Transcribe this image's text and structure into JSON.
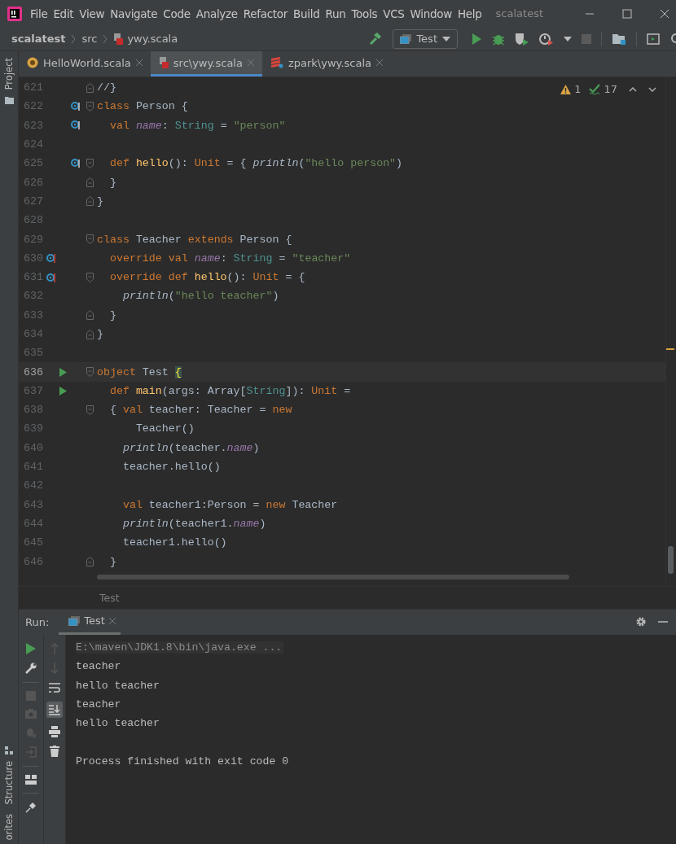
{
  "window": {
    "title": "scalatest",
    "menu": [
      "File",
      "Edit",
      "View",
      "Navigate",
      "Code",
      "Analyze",
      "Refactor",
      "Build",
      "Run",
      "Tools",
      "VCS",
      "Window",
      "Help"
    ]
  },
  "navbar": {
    "breadcrumbs": [
      "scalatest",
      "src",
      "ywy.scala"
    ],
    "run_config": "Test"
  },
  "tabs": [
    {
      "label": "HelloWorld.scala",
      "selected": false,
      "kind": "object"
    },
    {
      "label": "src\\ywy.scala",
      "selected": true,
      "kind": "file"
    },
    {
      "label": "zpark\\ywy.scala",
      "selected": false,
      "kind": "module"
    }
  ],
  "side_tools": {
    "top": "Project",
    "bottom": [
      "Structure",
      "orites"
    ]
  },
  "inspections": {
    "warnings": "1",
    "weak_warnings": "17"
  },
  "editor": {
    "lines": [
      {
        "number": "621",
        "current": false,
        "fold": {
          "kind": "end"
        },
        "tokens": [
          {
            "text": "//}",
            "kind": "plain"
          }
        ]
      },
      {
        "number": "622",
        "current": false,
        "fold": {
          "kind": "start"
        },
        "marker": {
          "kind": "implemented"
        },
        "tokens": [
          {
            "text": "class ",
            "kind": "kw"
          },
          {
            "text": "Person {",
            "kind": "plain"
          }
        ]
      },
      {
        "number": "623",
        "current": false,
        "marker": {
          "kind": "implemented"
        },
        "tokens": [
          {
            "text": "  val ",
            "kind": "kw"
          },
          {
            "text": "name",
            "kind": "field"
          },
          {
            "text": ": ",
            "kind": "plain"
          },
          {
            "text": "String",
            "kind": "type"
          },
          {
            "text": " = ",
            "kind": "plain"
          },
          {
            "text": "\"person\"",
            "kind": "str"
          }
        ]
      },
      {
        "number": "624",
        "current": false
      },
      {
        "number": "625",
        "current": false,
        "fold": {
          "kind": "start"
        },
        "marker": {
          "kind": "implemented"
        },
        "tokens": [
          {
            "text": "  def ",
            "kind": "kw"
          },
          {
            "text": "hello",
            "kind": "fn"
          },
          {
            "text": "(): ",
            "kind": "plain"
          },
          {
            "text": "Unit",
            "kind": "kw"
          },
          {
            "text": " = { ",
            "kind": "plain"
          },
          {
            "text": "println",
            "kind": "call"
          },
          {
            "text": "(",
            "kind": "plain"
          },
          {
            "text": "\"hello person\"",
            "kind": "str"
          },
          {
            "text": ")",
            "kind": "plain"
          }
        ]
      },
      {
        "number": "626",
        "current": false,
        "fold": {
          "kind": "end"
        },
        "tokens": [
          {
            "text": "  }",
            "kind": "plain"
          }
        ]
      },
      {
        "number": "627",
        "current": false,
        "fold": {
          "kind": "end"
        },
        "tokens": [
          {
            "text": "}",
            "kind": "plain"
          }
        ]
      },
      {
        "number": "628",
        "current": false
      },
      {
        "number": "629",
        "current": false,
        "fold": {
          "kind": "start"
        },
        "tokens": [
          {
            "text": "class",
            "kind": "kw"
          },
          {
            "text": " Teacher ",
            "kind": "plain"
          },
          {
            "text": "extends",
            "kind": "kw"
          },
          {
            "text": " Person {",
            "kind": "plain"
          }
        ]
      },
      {
        "number": "630",
        "current": false,
        "marker": {
          "kind": "overrides"
        },
        "tokens": [
          {
            "text": "  override val ",
            "kind": "kw"
          },
          {
            "text": "name",
            "kind": "field"
          },
          {
            "text": ": ",
            "kind": "plain"
          },
          {
            "text": "String",
            "kind": "type"
          },
          {
            "text": " = ",
            "kind": "plain"
          },
          {
            "text": "\"teacher\"",
            "kind": "str"
          }
        ]
      },
      {
        "number": "631",
        "current": false,
        "fold": {
          "kind": "start"
        },
        "marker": {
          "kind": "overrides"
        },
        "tokens": [
          {
            "text": "  override def ",
            "kind": "kw"
          },
          {
            "text": "hello",
            "kind": "fn"
          },
          {
            "text": "(): ",
            "kind": "plain"
          },
          {
            "text": "Unit",
            "kind": "kw"
          },
          {
            "text": " = {",
            "kind": "plain"
          }
        ]
      },
      {
        "number": "632",
        "current": false,
        "tokens": [
          {
            "text": "    println",
            "kind": "call"
          },
          {
            "text": "(",
            "kind": "plain"
          },
          {
            "text": "\"hello teacher\"",
            "kind": "str"
          },
          {
            "text": ")",
            "kind": "plain"
          }
        ]
      },
      {
        "number": "633",
        "current": false,
        "fold": {
          "kind": "end"
        },
        "tokens": [
          {
            "text": "  }",
            "kind": "plain"
          }
        ]
      },
      {
        "number": "634",
        "current": false,
        "fold": {
          "kind": "end"
        },
        "tokens": [
          {
            "text": "}",
            "kind": "plain"
          }
        ]
      },
      {
        "number": "635",
        "current": false
      },
      {
        "number": "636",
        "current": true,
        "fold": {
          "kind": "start"
        },
        "marker": {
          "kind": "run"
        },
        "tokens": [
          {
            "text": "object",
            "kind": "kw"
          },
          {
            "text": " Test ",
            "kind": "plain"
          },
          {
            "text": "{",
            "kind": "brace"
          }
        ]
      },
      {
        "number": "637",
        "current": false,
        "marker": {
          "kind": "run"
        },
        "tokens": [
          {
            "text": "  def ",
            "kind": "kw"
          },
          {
            "text": "main",
            "kind": "fn"
          },
          {
            "text": "(args: Array[",
            "kind": "plain"
          },
          {
            "text": "String",
            "kind": "type"
          },
          {
            "text": "]): ",
            "kind": "plain"
          },
          {
            "text": "Unit",
            "kind": "kw"
          },
          {
            "text": " =",
            "kind": "plain"
          }
        ]
      },
      {
        "number": "638",
        "current": false,
        "fold": {
          "kind": "start"
        },
        "tokens": [
          {
            "text": "  { ",
            "kind": "plain"
          },
          {
            "text": "val",
            "kind": "kw"
          },
          {
            "text": " teacher: Teacher = ",
            "kind": "plain"
          },
          {
            "text": "new",
            "kind": "kw"
          }
        ]
      },
      {
        "number": "639",
        "current": false,
        "tokens": [
          {
            "text": "      Teacher()",
            "kind": "plain"
          }
        ]
      },
      {
        "number": "640",
        "current": false,
        "tokens": [
          {
            "text": "    println",
            "kind": "call"
          },
          {
            "text": "(teacher.",
            "kind": "plain"
          },
          {
            "text": "name",
            "kind": "field"
          },
          {
            "text": ")",
            "kind": "plain"
          }
        ]
      },
      {
        "number": "641",
        "current": false,
        "tokens": [
          {
            "text": "    teacher.hello()",
            "kind": "plain"
          }
        ]
      },
      {
        "number": "642",
        "current": false
      },
      {
        "number": "643",
        "current": false,
        "tokens": [
          {
            "text": "    val",
            "kind": "kw"
          },
          {
            "text": " teacher1:Person = ",
            "kind": "plain"
          },
          {
            "text": "new",
            "kind": "kw"
          },
          {
            "text": " Teacher",
            "kind": "plain"
          }
        ]
      },
      {
        "number": "644",
        "current": false,
        "tokens": [
          {
            "text": "    println",
            "kind": "call"
          },
          {
            "text": "(teacher1.",
            "kind": "plain"
          },
          {
            "text": "name",
            "kind": "field"
          },
          {
            "text": ")",
            "kind": "plain"
          }
        ]
      },
      {
        "number": "645",
        "current": false,
        "tokens": [
          {
            "text": "    teacher1.hello()",
            "kind": "plain"
          }
        ]
      },
      {
        "number": "646",
        "current": false,
        "fold": {
          "kind": "end"
        },
        "tokens": [
          {
            "text": "  }",
            "kind": "plain"
          }
        ]
      }
    ]
  },
  "breadcrumb": "Test",
  "run": {
    "label": "Run:",
    "tab": "Test",
    "autoscroll": true,
    "output": [
      {
        "text": "E:\\maven\\JDK1.8\\bin\\java.exe ...",
        "kind": "command"
      },
      {
        "text": "teacher",
        "kind": "stdout"
      },
      {
        "text": "hello teacher",
        "kind": "stdout"
      },
      {
        "text": "teacher",
        "kind": "stdout"
      },
      {
        "text": "hello teacher",
        "kind": "stdout"
      },
      {
        "kind": "blank"
      },
      {
        "text": "Process finished with exit code 0",
        "kind": "stdout"
      }
    ]
  }
}
